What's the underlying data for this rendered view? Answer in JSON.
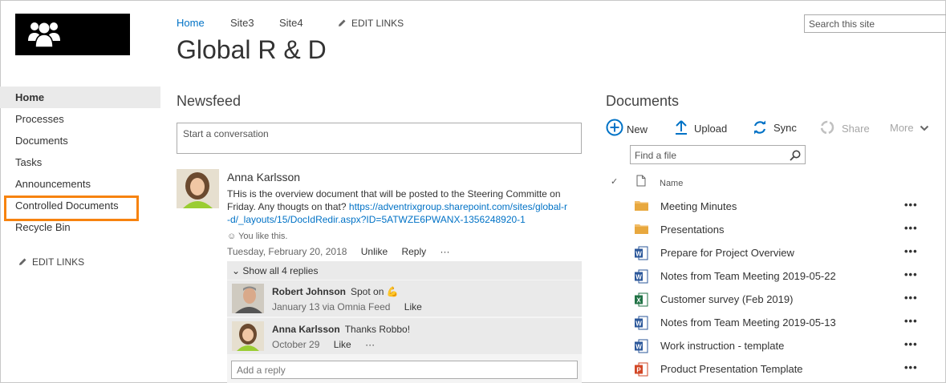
{
  "site": {
    "title": "Global R & D",
    "top_nav": [
      "Home",
      "Site3",
      "Site4"
    ],
    "edit_links": "EDIT LINKS",
    "search_placeholder": "Search this site"
  },
  "left_nav": {
    "items": [
      "Home",
      "Processes",
      "Documents",
      "Tasks",
      "Announcements",
      "Controlled Documents",
      "Recycle Bin"
    ],
    "edit_links": "EDIT LINKS",
    "highlight_color": "#f7830f"
  },
  "newsfeed": {
    "title": "Newsfeed",
    "conversation_placeholder": "Start a conversation",
    "post": {
      "author": "Anna Karlsson",
      "text": "THis is the overview document that will be posted to the Steering Committe on Friday. Any thougts on that?",
      "link": "https://adventrixgroup.sharepoint.com/sites/global-r-d/_layouts/15/DocIdRedir.aspx?ID=5ATWZE6PWANX-1356248920-1",
      "like_status": "You like this.",
      "date": "Tuesday, February 20, 2018",
      "actions": [
        "Unlike",
        "Reply",
        "···"
      ]
    },
    "show_all_replies": "Show all 4 replies",
    "replies": [
      {
        "author": "Robert Johnson",
        "message": "Spot on",
        "meta": "January 13 via Omnia Feed",
        "actions": [
          "Like"
        ]
      },
      {
        "author": "Anna Karlsson",
        "message": "Thanks Robbo!",
        "meta": "October 29",
        "actions": [
          "Like",
          "···"
        ]
      }
    ],
    "add_reply_placeholder": "Add a reply"
  },
  "documents": {
    "title": "Documents",
    "toolbar": {
      "new": "New",
      "upload": "Upload",
      "sync": "Sync",
      "share": "Share",
      "more": "More"
    },
    "find_placeholder": "Find a file",
    "column_name": "Name",
    "files": [
      {
        "name": "Meeting Minutes",
        "type": "folder-icon"
      },
      {
        "name": "Presentations",
        "type": "folder-icon"
      },
      {
        "name": "Prepare for Project Overview",
        "type": "word-icon"
      },
      {
        "name": "Notes from Team Meeting 2019-05-22",
        "type": "word-icon"
      },
      {
        "name": "Customer survey (Feb 2019)",
        "type": "excel-icon"
      },
      {
        "name": "Notes from Team Meeting 2019-05-13",
        "type": "word-icon"
      },
      {
        "name": "Work instruction - template",
        "type": "word-icon"
      },
      {
        "name": "Product Presentation Template",
        "type": "powerpoint-icon"
      }
    ],
    "row_menu": "•••"
  },
  "colors": {
    "accent": "#0072c6",
    "highlight": "#f7830f"
  }
}
